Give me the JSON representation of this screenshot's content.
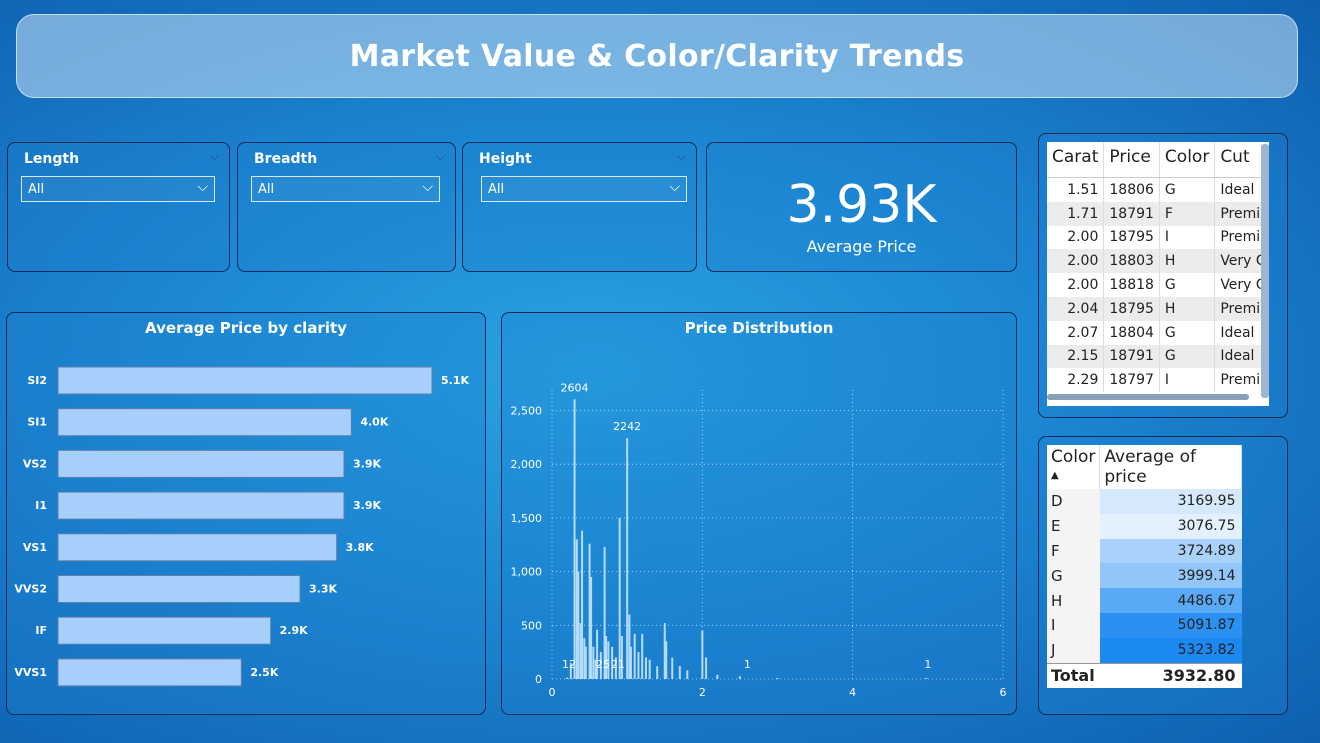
{
  "header": {
    "title": "Market Value & Color/Clarity Trends"
  },
  "slicers": [
    {
      "label": "Length",
      "value": "All"
    },
    {
      "label": "Breadth",
      "value": "All"
    },
    {
      "label": "Height",
      "value": "All"
    }
  ],
  "kpi": {
    "value": "3.93K",
    "label": "Average Price"
  },
  "clarity_chart": {
    "title": "Average Price by clarity",
    "bar_color": "#a7cffb",
    "categories": [
      "SI2",
      "SI1",
      "VS2",
      "I1",
      "VS1",
      "VVS2",
      "IF",
      "VVS1"
    ],
    "value_labels": [
      "5.1K",
      "4.0K",
      "3.9K",
      "3.9K",
      "3.8K",
      "3.3K",
      "2.9K",
      "2.5K"
    ]
  },
  "dist_chart": {
    "title": "Price Distribution",
    "y_ticks": [
      "0",
      "500",
      "1,000",
      "1,500",
      "2,000",
      "2,500"
    ],
    "x_ticks": [
      "0",
      "2",
      "4",
      "6"
    ],
    "annotations": [
      "2604",
      "2242",
      "12",
      "25",
      "21",
      "1",
      "1"
    ]
  },
  "chart_data": [
    {
      "type": "bar",
      "title": "Average Price by clarity",
      "categories": [
        "SI2",
        "SI1",
        "VS2",
        "I1",
        "VS1",
        "VVS2",
        "IF",
        "VVS1"
      ],
      "values": [
        5100,
        4000,
        3900,
        3900,
        3800,
        3300,
        2900,
        2500
      ]
    },
    {
      "type": "bar",
      "title": "Price Distribution",
      "ylim": [
        0,
        2700
      ],
      "xlim": [
        0,
        6
      ],
      "x": [
        0.2,
        0.25,
        0.3,
        0.33,
        0.35,
        0.38,
        0.4,
        0.43,
        0.45,
        0.5,
        0.52,
        0.55,
        0.58,
        0.6,
        0.65,
        0.7,
        0.72,
        0.75,
        0.8,
        0.85,
        0.9,
        0.93,
        1.0,
        1.03,
        1.05,
        1.1,
        1.15,
        1.2,
        1.25,
        1.3,
        1.4,
        1.5,
        1.52,
        1.6,
        1.7,
        1.8,
        2.0,
        2.05,
        2.2,
        2.5,
        3.0,
        4.98
      ],
      "values": [
        12,
        150,
        2604,
        1300,
        1000,
        520,
        1380,
        380,
        300,
        1260,
        950,
        300,
        180,
        460,
        250,
        1230,
        400,
        350,
        300,
        200,
        1500,
        400,
        2242,
        600,
        300,
        420,
        250,
        420,
        200,
        180,
        120,
        520,
        350,
        200,
        120,
        80,
        450,
        200,
        40,
        25,
        1,
        1
      ]
    }
  ],
  "diamond_table": {
    "headers": [
      "Carat",
      "Price",
      "Color",
      "Cut"
    ],
    "rows": [
      [
        "1.51",
        "18806",
        "G",
        "Ideal"
      ],
      [
        "1.71",
        "18791",
        "F",
        "Premium"
      ],
      [
        "2.00",
        "18795",
        "I",
        "Premium"
      ],
      [
        "2.00",
        "18803",
        "H",
        "Very Good"
      ],
      [
        "2.00",
        "18818",
        "G",
        "Very Good"
      ],
      [
        "2.04",
        "18795",
        "H",
        "Premium"
      ],
      [
        "2.07",
        "18804",
        "G",
        "Ideal"
      ],
      [
        "2.15",
        "18791",
        "G",
        "Ideal"
      ],
      [
        "2.29",
        "18797",
        "I",
        "Premium"
      ]
    ]
  },
  "color_table": {
    "headers": [
      "Color",
      "Average of price"
    ],
    "rows": [
      {
        "color": "D",
        "avg": "3169.95",
        "bg": "#d6e9fc"
      },
      {
        "color": "E",
        "avg": "3076.75",
        "bg": "#e3f0fd"
      },
      {
        "color": "F",
        "avg": "3724.89",
        "bg": "#a9d1f9"
      },
      {
        "color": "G",
        "avg": "3999.14",
        "bg": "#92c5f8"
      },
      {
        "color": "H",
        "avg": "4486.67",
        "bg": "#5aa9f6"
      },
      {
        "color": "I",
        "avg": "5091.87",
        "bg": "#2a91f3"
      },
      {
        "color": "J",
        "avg": "5323.82",
        "bg": "#1c89f2"
      }
    ],
    "total_label": "Total",
    "total_value": "3932.80"
  }
}
